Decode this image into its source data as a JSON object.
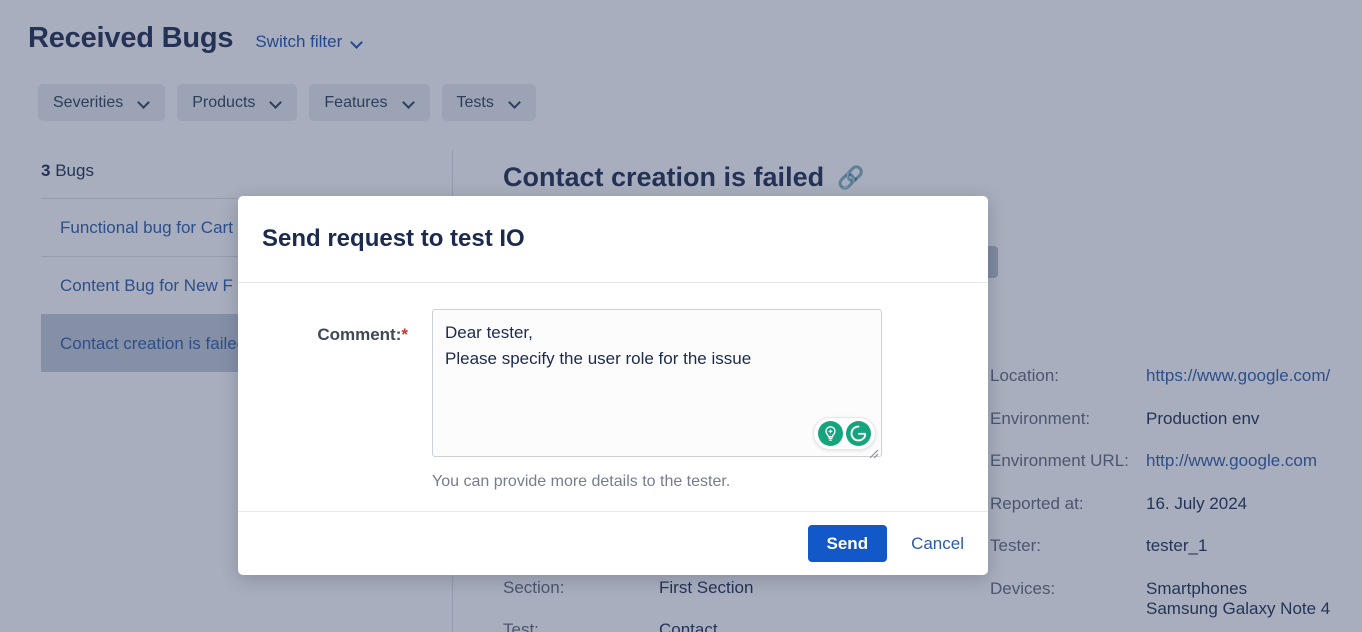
{
  "header": {
    "title": "Received Bugs",
    "switch_filter_label": "Switch filter"
  },
  "filters": [
    {
      "label": "Severities"
    },
    {
      "label": "Products"
    },
    {
      "label": "Features"
    },
    {
      "label": "Tests"
    }
  ],
  "bug_list": {
    "count": "3",
    "count_suffix": "Bugs",
    "items": [
      {
        "label": "Functional bug for Cart",
        "selected": false
      },
      {
        "label": "Content Bug for New F",
        "selected": false
      },
      {
        "label": "Contact creation is failed",
        "selected": true
      }
    ]
  },
  "detail": {
    "title": "Contact creation is failed",
    "left_column": [
      {
        "label": "Section:",
        "value": "First Section"
      }
    ],
    "cut_row": {
      "label": "Test:",
      "value": "Contact"
    },
    "right_column": [
      {
        "label": "Location:",
        "value": "https://www.google.com/",
        "is_link": true
      },
      {
        "label": "Environment:",
        "value": "Production env",
        "is_link": false
      },
      {
        "label": "Environment URL:",
        "value": "http://www.google.com",
        "is_link": true
      },
      {
        "label": "Reported at:",
        "value": "16. July 2024",
        "is_link": false
      },
      {
        "label": "Tester:",
        "value": "tester_1",
        "is_link": false
      },
      {
        "label": "Devices:",
        "value": "Smartphones",
        "value2": "Samsung Galaxy Note 4",
        "is_link": false
      }
    ]
  },
  "modal": {
    "title": "Send request to test IO",
    "comment_label": "Comment:",
    "required_marker": "*",
    "comment_value": "Dear tester,\nPlease specify the user role for the issue",
    "comment_placeholder": "",
    "hint": "You can provide more details to the tester.",
    "send_label": "Send",
    "cancel_label": "Cancel",
    "grammarly": {
      "bulb_icon": "lightbulb-icon",
      "logo_icon": "grammarly-logo-icon"
    }
  },
  "colors": {
    "accent_blue": "#1258c8",
    "link_blue": "#2d5ba8",
    "title_navy": "#1b2a4e",
    "required_red": "#d0322f",
    "grammarly_green": "#15a47e",
    "overlay": "rgba(47,62,97,0.42)"
  }
}
